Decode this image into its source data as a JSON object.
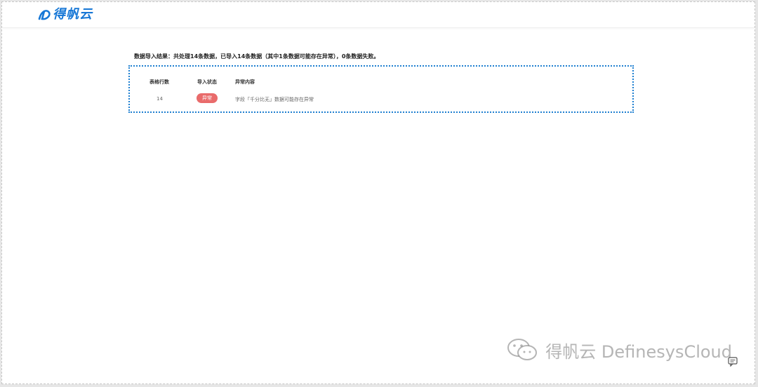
{
  "header": {
    "logo_text": "得帆云"
  },
  "import_result": {
    "summary": "数据导入结果：共处理14条数据，已导入14条数据（其中1条数据可能存在异常），0条数据失败。",
    "columns": [
      "表格行数",
      "导入状态",
      "异常内容"
    ],
    "rows": [
      {
        "row_number": "14",
        "status": "异常",
        "detail": "字段「千分比无」数据可能存在异常"
      }
    ]
  },
  "watermark": {
    "text": "得帆云 DefinesysCloud"
  },
  "colors": {
    "brand": "#1677d6",
    "box_border": "#1e7fd0",
    "status_error": "#e96b6b"
  },
  "icons": {
    "logo": "definesys-logo-icon",
    "watermark": "wechat-icon",
    "comment": "comment-icon"
  }
}
